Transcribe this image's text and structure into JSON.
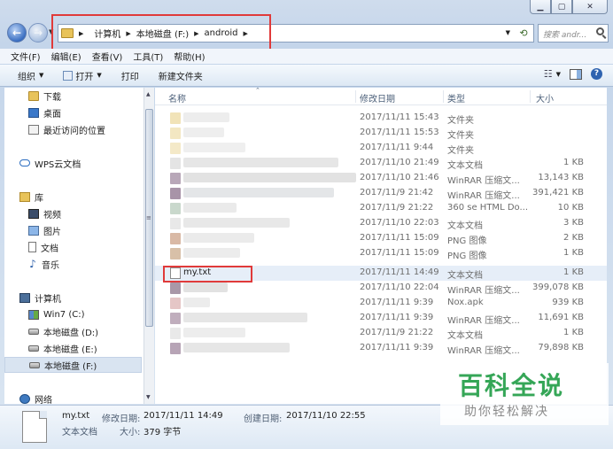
{
  "address": {
    "crumbs": [
      "计算机",
      "本地磁盘 (F:)",
      "android"
    ],
    "search_placeholder": "搜索 andr..."
  },
  "menu": [
    "文件(F)",
    "编辑(E)",
    "查看(V)",
    "工具(T)",
    "帮助(H)"
  ],
  "toolbar": {
    "organize": "组织",
    "open": "打开",
    "print": "打印",
    "new_folder": "新建文件夹"
  },
  "sidebar": {
    "items": [
      {
        "label": "下载",
        "icon": "folder-icon"
      },
      {
        "label": "桌面",
        "icon": "desktop-icon"
      },
      {
        "label": "最近访问的位置",
        "icon": "recent-places-icon"
      },
      {
        "label": "WPS云文档",
        "icon": "cloud-icon"
      },
      {
        "label": "库",
        "icon": "library-icon"
      },
      {
        "label": "视频",
        "icon": "video-icon"
      },
      {
        "label": "图片",
        "icon": "pictures-icon"
      },
      {
        "label": "文档",
        "icon": "documents-icon"
      },
      {
        "label": "音乐",
        "icon": "music-icon"
      },
      {
        "label": "计算机",
        "icon": "computer-icon"
      },
      {
        "label": "Win7 (C:)",
        "icon": "windows-drive-icon"
      },
      {
        "label": "本地磁盘 (D:)",
        "icon": "drive-icon"
      },
      {
        "label": "本地磁盘 (E:)",
        "icon": "drive-icon"
      },
      {
        "label": "本地磁盘 (F:)",
        "icon": "drive-icon",
        "selected": true
      },
      {
        "label": "网络",
        "icon": "network-icon"
      }
    ]
  },
  "columns": {
    "name": "名称",
    "date": "修改日期",
    "type": "类型",
    "size": "大小"
  },
  "files": [
    {
      "name": "",
      "date": "2017/11/11 15:43",
      "type": "文件夹",
      "size": ""
    },
    {
      "name": "",
      "date": "2017/11/11 15:53",
      "type": "文件夹",
      "size": ""
    },
    {
      "name": "",
      "date": "2017/11/11 9:44",
      "type": "文件夹",
      "size": ""
    },
    {
      "name": "",
      "date": "2017/11/10 21:49",
      "type": "文本文档",
      "size": "1 KB"
    },
    {
      "name": "",
      "date": "2017/11/10 21:46",
      "type": "WinRAR 压缩文...",
      "size": "13,143 KB"
    },
    {
      "name": "",
      "date": "2017/11/9 21:42",
      "type": "WinRAR 压缩文...",
      "size": "391,421 KB"
    },
    {
      "name": "",
      "date": "2017/11/9 21:22",
      "type": "360 se HTML Do...",
      "size": "10 KB"
    },
    {
      "name": "",
      "date": "2017/11/10 22:03",
      "type": "文本文档",
      "size": "3 KB"
    },
    {
      "name": "",
      "date": "2017/11/11 15:09",
      "type": "PNG 图像",
      "size": "2 KB"
    },
    {
      "name": "",
      "date": "2017/11/11 15:09",
      "type": "PNG 图像",
      "size": "1 KB"
    },
    {
      "name": "my.txt",
      "date": "2017/11/11 14:49",
      "type": "文本文档",
      "size": "1 KB",
      "selected": true
    },
    {
      "name": "",
      "date": "2017/11/10 22:04",
      "type": "WinRAR 压缩文...",
      "size": "399,078 KB"
    },
    {
      "name": "",
      "date": "2017/11/11 9:39",
      "type": "Nox.apk",
      "size": "939 KB"
    },
    {
      "name": "",
      "date": "2017/11/11 9:39",
      "type": "WinRAR 压缩文...",
      "size": "11,691 KB"
    },
    {
      "name": "",
      "date": "2017/11/9 21:22",
      "type": "文本文档",
      "size": "1 KB"
    },
    {
      "name": "",
      "date": "2017/11/11 9:39",
      "type": "WinRAR 压缩文...",
      "size": "79,898 KB"
    }
  ],
  "details": {
    "name": "my.txt",
    "type": "文本文档",
    "modified_label": "修改日期:",
    "modified_value": "2017/11/11 14:49",
    "created_label": "创建日期:",
    "created_value": "2017/11/10 22:55",
    "size_label": "大小:",
    "size_value": "379 字节"
  },
  "watermark": {
    "title": "百科全说",
    "subtitle": "助你轻松解决"
  },
  "colors": {
    "highlight_box": "#e03a3a",
    "selection": "#d9e4f1",
    "watermark_green": "#35a657"
  }
}
